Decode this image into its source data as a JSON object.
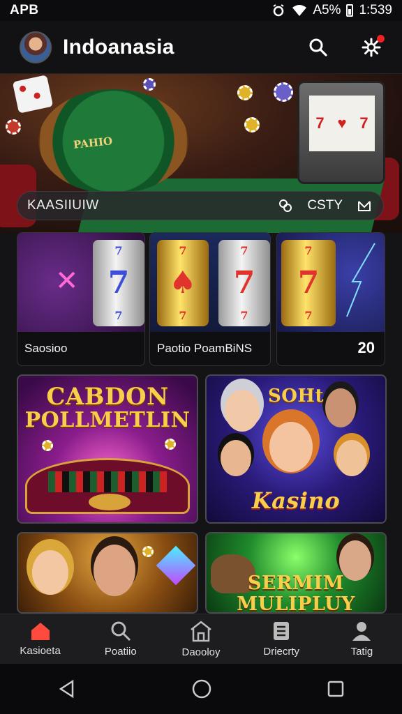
{
  "status_bar": {
    "carrier": "APB",
    "battery_text": "A5%",
    "time": "1:539"
  },
  "header": {
    "title": "Indoanasia",
    "icons": [
      "search-icon",
      "settings-gear-icon"
    ],
    "notification_color": "#ee2222"
  },
  "hero": {
    "table_text": "PAHIO",
    "search_strip": {
      "query": "KAASIIUIW",
      "right_text": "CSTY"
    }
  },
  "slots": [
    {
      "label": "Saosioo",
      "count": ""
    },
    {
      "label": "Paotio PoamBiNS",
      "count": ""
    },
    {
      "label": "",
      "count": "20"
    }
  ],
  "games": [
    {
      "title_line1": "CABDON",
      "title_line2": "POLLMETLIN"
    },
    {
      "title_top": "SOHt",
      "title_bottom": "Kasino"
    },
    {
      "title": ""
    },
    {
      "title_line1": "SERMIM",
      "title_line2": "MULIPLUY"
    }
  ],
  "bottom_nav": [
    {
      "label": "Kasioeta",
      "icon": "home-icon",
      "active": true
    },
    {
      "label": "Poatiio",
      "icon": "search-icon",
      "active": false
    },
    {
      "label": "Daooloy",
      "icon": "house-icon",
      "active": false
    },
    {
      "label": "Driecrty",
      "icon": "document-icon",
      "active": false
    },
    {
      "label": "Tatig",
      "icon": "user-icon",
      "active": false
    }
  ],
  "colors": {
    "accent": "#ff4b3e",
    "background": "#141416",
    "gold": "#f5c542"
  }
}
